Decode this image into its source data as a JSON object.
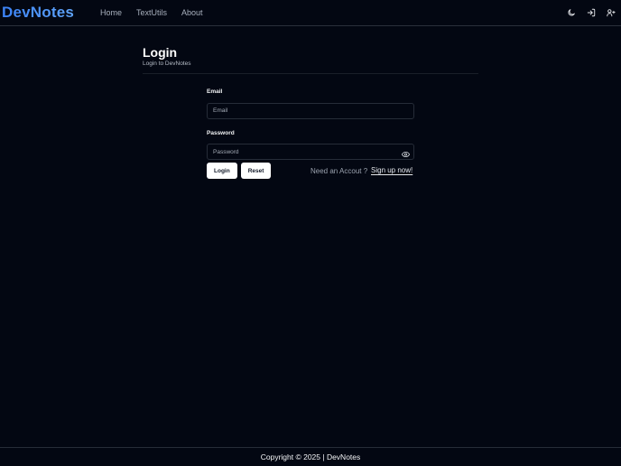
{
  "nav": {
    "brand": "DevNotes",
    "links": [
      "Home",
      "TextUtils",
      "About"
    ],
    "icons": [
      "moon-icon",
      "login-icon",
      "user-plus-icon"
    ]
  },
  "header": {
    "title": "Login",
    "subtitle": "Login to DevNotes"
  },
  "form": {
    "email_label": "Email",
    "email_placeholder": "Email",
    "password_label": "Password",
    "password_placeholder": "Password",
    "login_button": "Login",
    "reset_button": "Reset",
    "need_account": "Need an Accout ?",
    "signup_link": "Sign up now!"
  },
  "footer": {
    "copyright": "Copyright © 2025 | DevNotes"
  },
  "colors": {
    "background": "#030712",
    "brand": "#3b82f6",
    "button_bg": "#ffffff"
  }
}
